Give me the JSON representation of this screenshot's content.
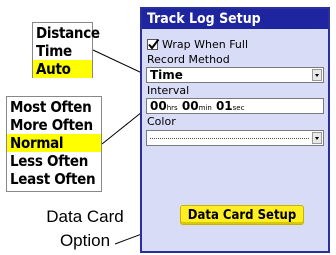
{
  "record_popup": {
    "items": [
      "Distance",
      "Time",
      "Auto"
    ],
    "selected": "Auto"
  },
  "interval_popup": {
    "items": [
      "Most Often",
      "More Often",
      "Normal",
      "Less Often",
      "Least Often"
    ],
    "selected": "Normal"
  },
  "panel": {
    "title": "Track Log Setup",
    "wrap_label": "Wrap When Full",
    "wrap_checked": true,
    "record_method_label": "Record Method",
    "record_method_value": "Time",
    "interval_label": "Interval",
    "interval": {
      "hrs_value": "00",
      "hrs_unit": "hrs",
      "min_value": "00",
      "min_unit": "min",
      "sec_value": "01",
      "sec_unit": "sec"
    },
    "color_label": "Color",
    "data_card_button": "Data Card Setup"
  },
  "callout": {
    "line1": "Data Card",
    "line2": "Option"
  },
  "colors": {
    "title_bar": "#1f259f",
    "panel_bg": "#d9dcf7",
    "highlight": "#ffff00",
    "button": "#ffee22"
  }
}
